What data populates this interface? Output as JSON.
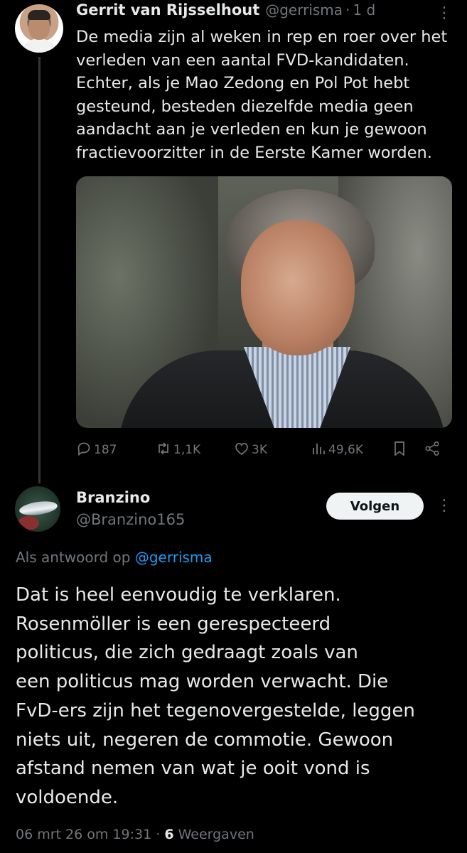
{
  "tweet": {
    "author_name": "Gerrit van Rijsselhout",
    "author_handle": "@gerrisma",
    "separator": "·",
    "time": "1 d",
    "body_lines": [
      "De media zijn al weken in rep en roer over het",
      "verleden van een aantal FVD-kandidaten.",
      "Echter, als je Mao Zedong en Pol Pot hebt",
      "gesteund, besteden diezelfde media geen",
      "aandacht aan je verleden en kun je gewoon",
      "fractievoorzitter in de Eerste Kamer worden."
    ],
    "stats": {
      "replies": "187",
      "reposts": "1,1K",
      "likes": "3K",
      "views": "49,6K"
    }
  },
  "reply": {
    "author_name": "Branzino",
    "author_handle": "@Branzino165",
    "follow_label": "Volgen",
    "context_prefix": "Als antwoord op",
    "context_handle": "@gerrisma",
    "body_lines": [
      "Dat is heel eenvoudig te verklaren.",
      "Rosenmöller is een gerespecteerd",
      "politicus, die zich gedraagt zoals van",
      "een politicus mag worden verwacht. Die",
      "FvD-ers zijn het tegenovergestelde, leggen",
      "niets uit, negeren de commotie. Gewoon",
      "afstand nemen van wat je ooit vond is",
      "voldoende."
    ],
    "date": "06 mrt 26 om 19:31",
    "separator": "·",
    "view_count": "6",
    "view_label": "Weergaven"
  },
  "icons": {
    "reply": "comment-icon",
    "repost": "repost-icon",
    "like": "heart-icon",
    "views": "views-bar-icon",
    "bookmark": "bookmark-icon",
    "share": "share-icon",
    "more": "more-dots-icon"
  },
  "colors": {
    "background": "#000000",
    "text": "#e7e9ea",
    "muted": "#71767b",
    "link": "#1d9bf0",
    "button_bg": "#eff3f4"
  }
}
